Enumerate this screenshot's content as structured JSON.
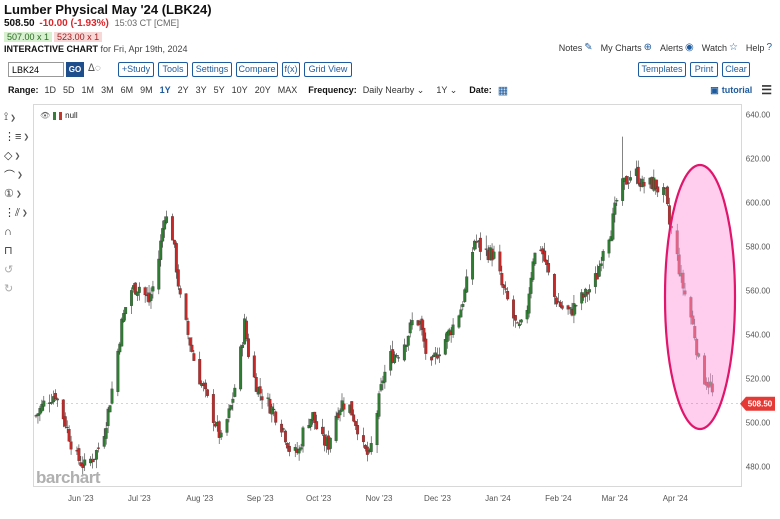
{
  "header": {
    "title": "Lumber Physical May '24 (LBK24)",
    "last": "508.50",
    "change": "-10.00 (-1.93%)",
    "time": "15:03 CT [CME]",
    "bid": "507.00 x 1",
    "ask": "523.00 x 1",
    "interactive_label": "INTERACTIVE CHART",
    "interactive_sub": "for Fri, Apr 19th, 2024"
  },
  "top_links": {
    "notes": "Notes",
    "my_charts": "My Charts",
    "alerts": "Alerts",
    "watch": "Watch",
    "help": "Help"
  },
  "toolbar": {
    "symbol": "LBK24",
    "go": "GO",
    "study": "+Study",
    "tools": "Tools",
    "settings": "Settings",
    "compare": "Compare",
    "fx": "f(x)",
    "grid_view": "Grid View",
    "templates": "Templates",
    "print": "Print",
    "clear": "Clear"
  },
  "range_bar": {
    "range_label": "Range:",
    "ranges": [
      "1D",
      "5D",
      "1M",
      "3M",
      "6M",
      "9M",
      "1Y",
      "2Y",
      "3Y",
      "5Y",
      "10Y",
      "20Y",
      "MAX"
    ],
    "active_range": "1Y",
    "frequency_label": "Frequency:",
    "frequency": "Daily Nearby",
    "period": "1Y",
    "date_label": "Date:",
    "tutorial": "tutorial"
  },
  "legend": {
    "label": "null"
  },
  "watermark": "barchart",
  "chart_data": {
    "type": "candlestick",
    "title": "Lumber Physical May '24 (LBK24)",
    "last_price_label": "508.50",
    "last_price": 508.5,
    "y_ticks": [
      "640.00",
      "620.00",
      "600.00",
      "580.00",
      "560.00",
      "540.00",
      "520.00",
      "500.00",
      "480.00"
    ],
    "y_tick_values": [
      640,
      620,
      600,
      580,
      560,
      540,
      520,
      500,
      480
    ],
    "ylim": [
      472,
      643
    ],
    "x_ticks": [
      "Jun '23",
      "Jul '23",
      "Aug '23",
      "Sep '23",
      "Oct '23",
      "Nov '23",
      "Dec '23",
      "Jan '24",
      "Feb '24",
      "Mar '24",
      "Apr '24"
    ],
    "x_tick_days": [
      23,
      53,
      84,
      115,
      145,
      176,
      206,
      237,
      268,
      297,
      328
    ],
    "x_range_days": [
      0,
      353
    ],
    "anchor_closes": [
      [
        0,
        503
      ],
      [
        5,
        510
      ],
      [
        10,
        513
      ],
      [
        15,
        500
      ],
      [
        20,
        485
      ],
      [
        25,
        480
      ],
      [
        30,
        485
      ],
      [
        34,
        492
      ],
      [
        37,
        505
      ],
      [
        40,
        520
      ],
      [
        44,
        545
      ],
      [
        48,
        560
      ],
      [
        53,
        562
      ],
      [
        58,
        555
      ],
      [
        62,
        568
      ],
      [
        66,
        595
      ],
      [
        70,
        585
      ],
      [
        74,
        556
      ],
      [
        78,
        540
      ],
      [
        82,
        525
      ],
      [
        86,
        515
      ],
      [
        90,
        505
      ],
      [
        95,
        492
      ],
      [
        100,
        507
      ],
      [
        104,
        525
      ],
      [
        107,
        545
      ],
      [
        110,
        525
      ],
      [
        114,
        515
      ],
      [
        118,
        510
      ],
      [
        122,
        505
      ],
      [
        127,
        497
      ],
      [
        131,
        485
      ],
      [
        135,
        487
      ],
      [
        138,
        500
      ],
      [
        142,
        503
      ],
      [
        146,
        492
      ],
      [
        150,
        490
      ],
      [
        153,
        502
      ],
      [
        157,
        509
      ],
      [
        161,
        507
      ],
      [
        165,
        498
      ],
      [
        168,
        488
      ],
      [
        171,
        484
      ],
      [
        174,
        500
      ],
      [
        178,
        520
      ],
      [
        182,
        530
      ],
      [
        186,
        532
      ],
      [
        190,
        538
      ],
      [
        194,
        548
      ],
      [
        197,
        545
      ],
      [
        200,
        532
      ],
      [
        203,
        525
      ],
      [
        206,
        532
      ],
      [
        210,
        538
      ],
      [
        214,
        544
      ],
      [
        218,
        552
      ],
      [
        221,
        563
      ],
      [
        225,
        583
      ],
      [
        229,
        578
      ],
      [
        233,
        577
      ],
      [
        236,
        575
      ],
      [
        239,
        562
      ],
      [
        243,
        553
      ],
      [
        247,
        542
      ],
      [
        251,
        545
      ],
      [
        255,
        575
      ],
      [
        259,
        580
      ],
      [
        263,
        567
      ],
      [
        266,
        557
      ],
      [
        270,
        552
      ],
      [
        274,
        550
      ],
      [
        278,
        555
      ],
      [
        282,
        558
      ],
      [
        285,
        562
      ],
      [
        288,
        567
      ],
      [
        291,
        580
      ],
      [
        295,
        588
      ],
      [
        299,
        605
      ],
      [
        303,
        610
      ],
      [
        307,
        615
      ],
      [
        311,
        608
      ],
      [
        314,
        608
      ],
      [
        317,
        609
      ],
      [
        320,
        605
      ],
      [
        323,
        603
      ],
      [
        325,
        590
      ],
      [
        327,
        585
      ],
      [
        329,
        575
      ],
      [
        331,
        565
      ],
      [
        334,
        555
      ],
      [
        336,
        548
      ],
      [
        338,
        540
      ],
      [
        340,
        528
      ],
      [
        343,
        520
      ],
      [
        346,
        517
      ],
      [
        348,
        508.5
      ]
    ],
    "spikes": [
      [
        301,
        630
      ],
      [
        231,
        585
      ]
    ],
    "up_color": "#2e7d32",
    "down_color": "#c62828",
    "annotation": {
      "type": "ellipse",
      "stroke": "#e0156b",
      "fill": "#ff9ee0"
    }
  }
}
